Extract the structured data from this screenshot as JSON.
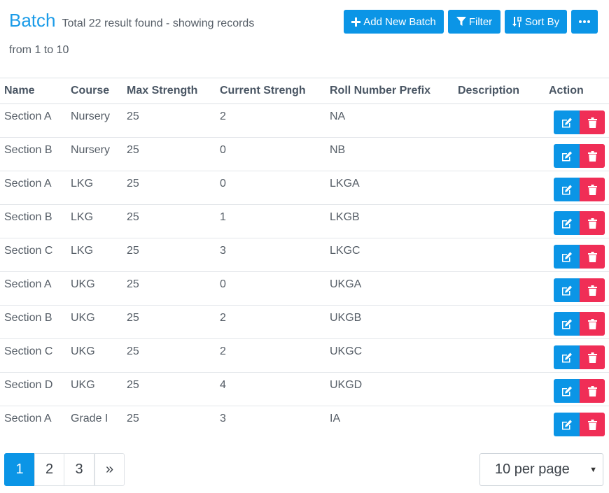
{
  "header": {
    "title": "Batch",
    "summary_line1": "Total 22 result found - showing records",
    "summary_line2": "from 1 to 10"
  },
  "toolbar": {
    "add_label": "Add New Batch",
    "filter_label": "Filter",
    "sort_label": "Sort By",
    "add_icon": "plus-icon",
    "filter_icon": "funnel-icon",
    "sort_icon": "sort-numeric-icon",
    "more_icon": "ellipsis-icon"
  },
  "table": {
    "columns": [
      "Name",
      "Course",
      "Max Strength",
      "Current Strengh",
      "Roll Number Prefix",
      "Description",
      "Action"
    ],
    "rows": [
      {
        "name": "Section A",
        "course": "Nursery",
        "max": "25",
        "current": "2",
        "prefix": "NA",
        "description": ""
      },
      {
        "name": "Section B",
        "course": "Nursery",
        "max": "25",
        "current": "0",
        "prefix": "NB",
        "description": ""
      },
      {
        "name": "Section A",
        "course": "LKG",
        "max": "25",
        "current": "0",
        "prefix": "LKGA",
        "description": ""
      },
      {
        "name": "Section B",
        "course": "LKG",
        "max": "25",
        "current": "1",
        "prefix": "LKGB",
        "description": ""
      },
      {
        "name": "Section C",
        "course": "LKG",
        "max": "25",
        "current": "3",
        "prefix": "LKGC",
        "description": ""
      },
      {
        "name": "Section A",
        "course": "UKG",
        "max": "25",
        "current": "0",
        "prefix": "UKGA",
        "description": ""
      },
      {
        "name": "Section B",
        "course": "UKG",
        "max": "25",
        "current": "2",
        "prefix": "UKGB",
        "description": ""
      },
      {
        "name": "Section C",
        "course": "UKG",
        "max": "25",
        "current": "2",
        "prefix": "UKGC",
        "description": ""
      },
      {
        "name": "Section D",
        "course": "UKG",
        "max": "25",
        "current": "4",
        "prefix": "UKGD",
        "description": ""
      },
      {
        "name": "Section A",
        "course": "Grade I",
        "max": "25",
        "current": "3",
        "prefix": "IA",
        "description": ""
      }
    ],
    "edit_icon": "edit-icon",
    "delete_icon": "trash-icon"
  },
  "pagination": {
    "pages": [
      "1",
      "2",
      "3"
    ],
    "next_label": "»",
    "current_page": "1",
    "per_page_selected": "10 per page"
  },
  "colors": {
    "accent": "#0b95e6",
    "title": "#1a9be8",
    "danger": "#f02e56"
  }
}
